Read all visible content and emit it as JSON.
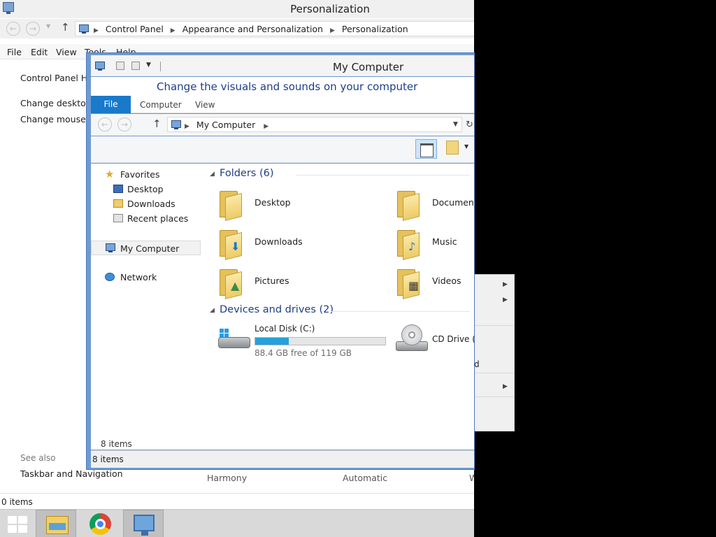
{
  "control_panel": {
    "title": "Personalization",
    "breadcrumb": [
      "Control Panel",
      "Appearance and Personalization",
      "Personalization"
    ],
    "menu": [
      "File",
      "Edit",
      "View",
      "Tools",
      "Help"
    ],
    "left_links": [
      "Control Panel Home",
      "Change desktop icons",
      "Change mouse pointers"
    ],
    "see_also_label": "See also",
    "see_also_link": "Taskbar and Navigation",
    "theme_labels": [
      "Harmony",
      "Automatic",
      "W"
    ],
    "status": "0 items"
  },
  "explorer": {
    "title": "My Computer",
    "cp_heading": "Change the visuals and sounds on your computer",
    "ribbon_tabs": [
      "File",
      "Computer",
      "View"
    ],
    "address": "My Computer",
    "nav": {
      "favorites": "Favorites",
      "desktop": "Desktop",
      "downloads": "Downloads",
      "recent": "Recent places",
      "my_computer": "My Computer",
      "network": "Network"
    },
    "folders_header": "Folders (6)",
    "folders": [
      "Desktop",
      "Documents",
      "Downloads",
      "Music",
      "Pictures",
      "Videos"
    ],
    "drives_header": "Devices and drives (2)",
    "drives": [
      {
        "name": "Local Disk (C:)",
        "free": "88.4 GB free of 119 GB",
        "used_fraction": 0.26
      },
      {
        "name": "CD Drive (D:)"
      }
    ],
    "items_inner": "8 items",
    "status": "8 items"
  },
  "context_menu": {
    "fragment": "d"
  },
  "taskbar": {
    "items": [
      "start-button",
      "file-explorer",
      "chrome",
      "control-panel"
    ]
  },
  "colors": {
    "accent": "#1979ca",
    "heading": "#1e3e87",
    "progress": "#26a0da"
  }
}
